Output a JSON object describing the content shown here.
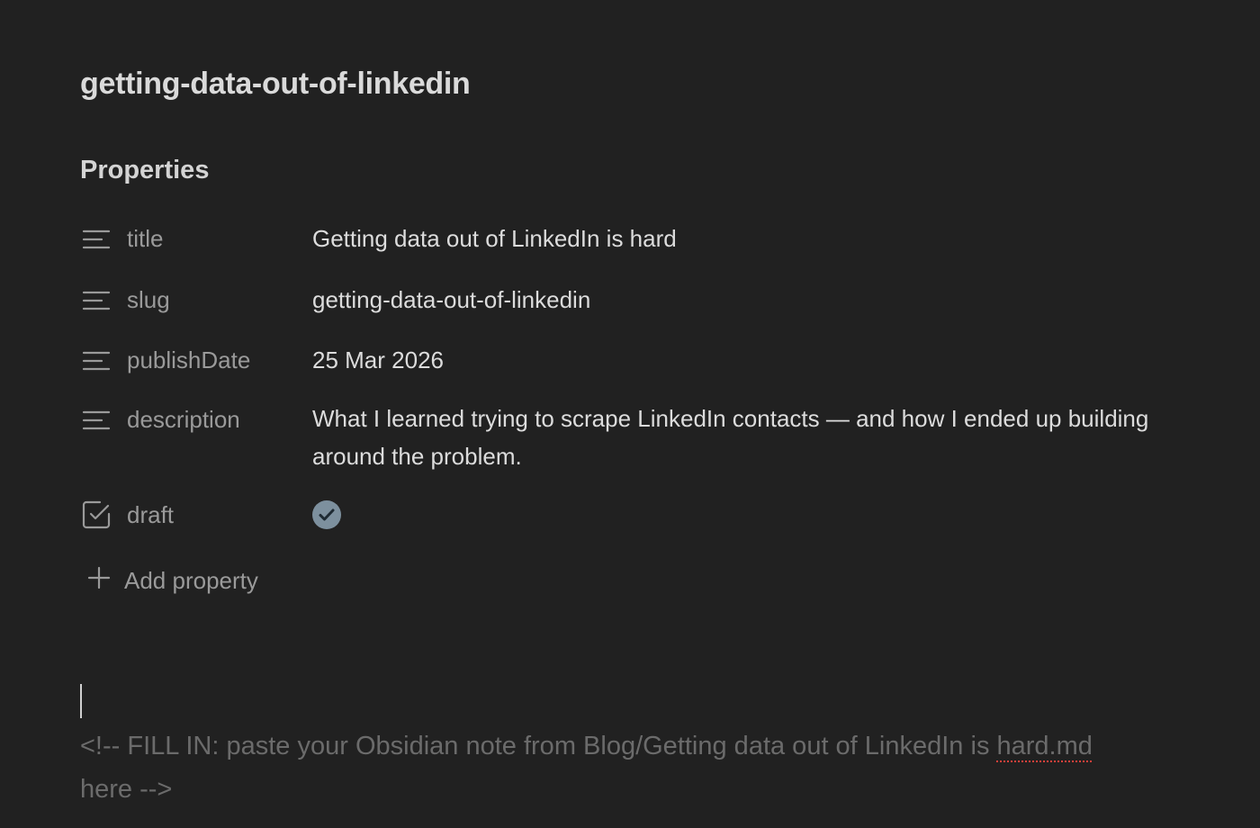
{
  "note": {
    "title": "getting-data-out-of-linkedin"
  },
  "properties": {
    "heading": "Properties",
    "items": [
      {
        "key": "title",
        "icon": "text-lines-icon",
        "value": "Getting data out of LinkedIn is hard"
      },
      {
        "key": "slug",
        "icon": "text-lines-icon",
        "value": "getting-data-out-of-linkedin"
      },
      {
        "key": "publishDate",
        "icon": "text-lines-icon",
        "value": "25 Mar 2026"
      },
      {
        "key": "description",
        "icon": "text-lines-icon",
        "value": "What I learned trying to scrape LinkedIn contacts — and how I ended up building around the problem."
      },
      {
        "key": "draft",
        "icon": "checkbox-icon",
        "checked": true
      }
    ],
    "add_label": "Add property"
  },
  "body": {
    "comment_part1": "<!-- FILL IN: paste your Obsidian note from Blog/Getting data out of LinkedIn is ",
    "comment_misspelled": "hard.md",
    "comment_part2": "here -->"
  },
  "colors": {
    "background": "#212121",
    "checkbox_fill": "#7d909e",
    "spellcheck": "#e0403a"
  }
}
